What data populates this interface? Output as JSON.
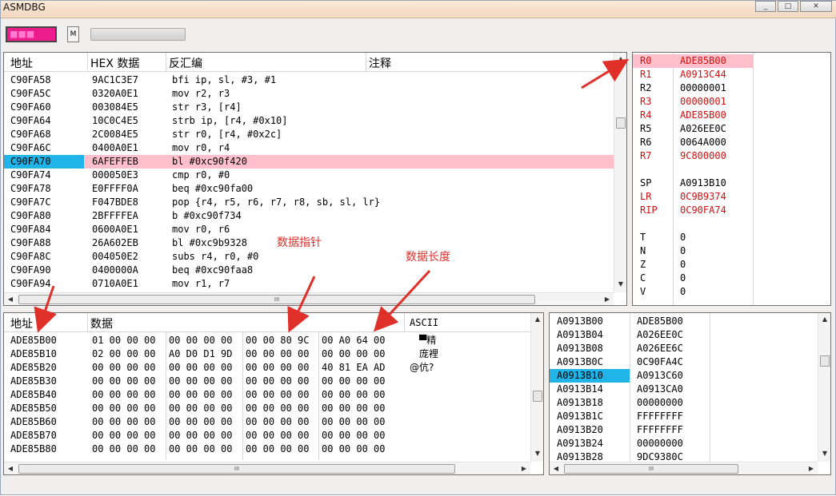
{
  "window": {
    "title": "ASMDBG",
    "buttons": [
      "_",
      "□",
      "✕"
    ]
  },
  "toolbar": {
    "status_box_text": "■■■",
    "m_button": "M"
  },
  "disasm": {
    "headers": [
      "地址",
      "HEX 数据",
      "反汇编",
      "注释"
    ],
    "rows": [
      {
        "addr": "C90FA58",
        "hex": "9AC1C3E7",
        "asm": "bfi ip, sl, #3, #1"
      },
      {
        "addr": "C90FA5C",
        "hex": "0320A0E1",
        "asm": "mov r2, r3"
      },
      {
        "addr": "C90FA60",
        "hex": "003084E5",
        "asm": "str r3, [r4]"
      },
      {
        "addr": "C90FA64",
        "hex": "10C0C4E5",
        "asm": "strb ip, [r4, #0x10]"
      },
      {
        "addr": "C90FA68",
        "hex": "2C0084E5",
        "asm": "str r0, [r4, #0x2c]"
      },
      {
        "addr": "C90FA6C",
        "hex": "0400A0E1",
        "asm": "mov r0, r4"
      },
      {
        "addr": "C90FA70",
        "hex": "6AFEFFEB",
        "asm": "bl #0xc90f420"
      },
      {
        "addr": "C90FA74",
        "hex": "000050E3",
        "asm": "cmp r0, #0"
      },
      {
        "addr": "C90FA78",
        "hex": "E0FFFF0A",
        "asm": "beq #0xc90fa00"
      },
      {
        "addr": "C90FA7C",
        "hex": "F047BDE8",
        "asm": "pop {r4, r5, r6, r7, r8, sb, sl, lr}"
      },
      {
        "addr": "C90FA80",
        "hex": "2BFFFFEA",
        "asm": "b #0xc90f734"
      },
      {
        "addr": "C90FA84",
        "hex": "0600A0E1",
        "asm": "mov r0, r6"
      },
      {
        "addr": "C90FA88",
        "hex": "26A602EB",
        "asm": "bl #0xc9b9328"
      },
      {
        "addr": "C90FA8C",
        "hex": "004050E2",
        "asm": "subs r4, r0, #0"
      },
      {
        "addr": "C90FA90",
        "hex": "0400000A",
        "asm": "beq #0xc90faa8"
      },
      {
        "addr": "C90FA94",
        "hex": "0710A0E1",
        "asm": "mov r1, r7"
      }
    ]
  },
  "registers": {
    "rows": [
      {
        "name": "R0",
        "value": "ADE85B00",
        "changed": true
      },
      {
        "name": "R1",
        "value": "A0913C44",
        "changed": true
      },
      {
        "name": "R2",
        "value": "00000001",
        "changed": false
      },
      {
        "name": "R3",
        "value": "00000001",
        "changed": true
      },
      {
        "name": "R4",
        "value": "ADE85B00",
        "changed": true
      },
      {
        "name": "R5",
        "value": "A026EE0C",
        "changed": false
      },
      {
        "name": "R6",
        "value": "0064A000",
        "changed": false
      },
      {
        "name": "R7",
        "value": "9C800000",
        "changed": true
      },
      {
        "name": "SP",
        "value": "A0913B10",
        "changed": false
      },
      {
        "name": "LR",
        "value": "0C9B9374",
        "changed": true
      },
      {
        "name": "RIP",
        "value": "0C90FA74",
        "changed": true
      },
      {
        "name": "T",
        "value": "0",
        "changed": false
      },
      {
        "name": "N",
        "value": "0",
        "changed": false
      },
      {
        "name": "Z",
        "value": "0",
        "changed": false
      },
      {
        "name": "C",
        "value": "0",
        "changed": false
      },
      {
        "name": "V",
        "value": "0",
        "changed": false
      }
    ]
  },
  "memory": {
    "headers": [
      "地址",
      "数据",
      "ASCII"
    ],
    "rows": [
      {
        "addr": "ADE85B00",
        "b1": "01 00 00 00",
        "b2": "00 00 00 00",
        "b3": "00 00 80 9C",
        "b4": "00 A0 64 00",
        "ascii": "　▀精"
      },
      {
        "addr": "ADE85B10",
        "b1": "02 00 00 00",
        "b2": "A0 D0 D1 9D",
        "b3": "00 00 00 00",
        "b4": "00 00 00 00",
        "ascii": "　庞裡"
      },
      {
        "addr": "ADE85B20",
        "b1": "00 00 00 00",
        "b2": "00 00 00 00",
        "b3": "00 00 00 00",
        "b4": "40 81 EA AD",
        "ascii": "@伉?"
      },
      {
        "addr": "ADE85B30",
        "b1": "00 00 00 00",
        "b2": "00 00 00 00",
        "b3": "00 00 00 00",
        "b4": "00 00 00 00",
        "ascii": ""
      },
      {
        "addr": "ADE85B40",
        "b1": "00 00 00 00",
        "b2": "00 00 00 00",
        "b3": "00 00 00 00",
        "b4": "00 00 00 00",
        "ascii": ""
      },
      {
        "addr": "ADE85B50",
        "b1": "00 00 00 00",
        "b2": "00 00 00 00",
        "b3": "00 00 00 00",
        "b4": "00 00 00 00",
        "ascii": ""
      },
      {
        "addr": "ADE85B60",
        "b1": "00 00 00 00",
        "b2": "00 00 00 00",
        "b3": "00 00 00 00",
        "b4": "00 00 00 00",
        "ascii": ""
      },
      {
        "addr": "ADE85B70",
        "b1": "00 00 00 00",
        "b2": "00 00 00 00",
        "b3": "00 00 00 00",
        "b4": "00 00 00 00",
        "ascii": ""
      },
      {
        "addr": "ADE85B80",
        "b1": "00 00 00 00",
        "b2": "00 00 00 00",
        "b3": "00 00 00 00",
        "b4": "00 00 00 00",
        "ascii": ""
      }
    ]
  },
  "stack": {
    "rows": [
      {
        "addr": "A0913B00",
        "value": "ADE85B00"
      },
      {
        "addr": "A0913B04",
        "value": "A026EE0C"
      },
      {
        "addr": "A0913B08",
        "value": "A026EE6C"
      },
      {
        "addr": "A0913B0C",
        "value": "0C90FA4C"
      },
      {
        "addr": "A0913B10",
        "value": "A0913C60"
      },
      {
        "addr": "A0913B14",
        "value": "A0913CA0"
      },
      {
        "addr": "A0913B18",
        "value": "00000000"
      },
      {
        "addr": "A0913B1C",
        "value": "FFFFFFFF"
      },
      {
        "addr": "A0913B20",
        "value": "FFFFFFFF"
      },
      {
        "addr": "A0913B24",
        "value": "00000000"
      },
      {
        "addr": "A0913B28",
        "value": "9DC9380C"
      }
    ]
  },
  "annotations": {
    "data_pointer": "数据指针",
    "data_length": "数据长度"
  },
  "colors": {
    "highlight_row": "#ffc0cb",
    "selection": "#20b4e8",
    "changed_register": "#d01010",
    "annotation": "#e0302a",
    "status_box": "#ec1c8c"
  }
}
